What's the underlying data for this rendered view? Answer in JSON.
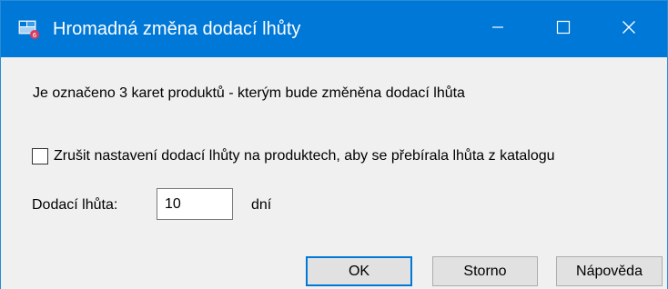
{
  "window": {
    "title": "Hromadná změna dodací lhůty",
    "icon": "app-logo-icon",
    "controls": {
      "minimize_icon": "minimize-icon",
      "maximize_icon": "maximize-icon",
      "close_icon": "close-icon"
    },
    "colors": {
      "titlebar": "#0078d7",
      "body": "#f0f0f0",
      "accent": "#0078d7"
    }
  },
  "content": {
    "info_text": "Je označeno 3 karet produktů - kterým bude změněna dodací lhůta",
    "checkbox": {
      "label": "Zrušit nastavení dodací lhůty na produktech, aby se přebírala lhůta z katalogu",
      "checked": false
    },
    "lead_time": {
      "label": "Dodací lhůta:",
      "value": "10",
      "unit": "dní"
    }
  },
  "buttons": {
    "ok": "OK",
    "cancel": "Storno",
    "help": "Nápověda"
  }
}
